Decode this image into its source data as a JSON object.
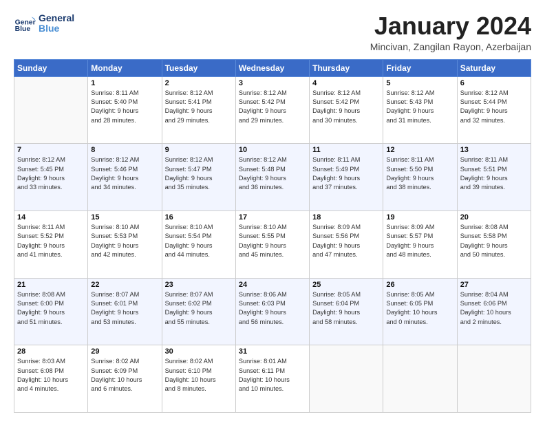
{
  "logo": {
    "line1": "General",
    "line2": "Blue"
  },
  "title": "January 2024",
  "subtitle": "Mincivan, Zangilan Rayon, Azerbaijan",
  "headers": [
    "Sunday",
    "Monday",
    "Tuesday",
    "Wednesday",
    "Thursday",
    "Friday",
    "Saturday"
  ],
  "weeks": [
    [
      {
        "num": "",
        "info": ""
      },
      {
        "num": "1",
        "info": "Sunrise: 8:11 AM\nSunset: 5:40 PM\nDaylight: 9 hours\nand 28 minutes."
      },
      {
        "num": "2",
        "info": "Sunrise: 8:12 AM\nSunset: 5:41 PM\nDaylight: 9 hours\nand 29 minutes."
      },
      {
        "num": "3",
        "info": "Sunrise: 8:12 AM\nSunset: 5:42 PM\nDaylight: 9 hours\nand 29 minutes."
      },
      {
        "num": "4",
        "info": "Sunrise: 8:12 AM\nSunset: 5:42 PM\nDaylight: 9 hours\nand 30 minutes."
      },
      {
        "num": "5",
        "info": "Sunrise: 8:12 AM\nSunset: 5:43 PM\nDaylight: 9 hours\nand 31 minutes."
      },
      {
        "num": "6",
        "info": "Sunrise: 8:12 AM\nSunset: 5:44 PM\nDaylight: 9 hours\nand 32 minutes."
      }
    ],
    [
      {
        "num": "7",
        "info": "Sunrise: 8:12 AM\nSunset: 5:45 PM\nDaylight: 9 hours\nand 33 minutes."
      },
      {
        "num": "8",
        "info": "Sunrise: 8:12 AM\nSunset: 5:46 PM\nDaylight: 9 hours\nand 34 minutes."
      },
      {
        "num": "9",
        "info": "Sunrise: 8:12 AM\nSunset: 5:47 PM\nDaylight: 9 hours\nand 35 minutes."
      },
      {
        "num": "10",
        "info": "Sunrise: 8:12 AM\nSunset: 5:48 PM\nDaylight: 9 hours\nand 36 minutes."
      },
      {
        "num": "11",
        "info": "Sunrise: 8:11 AM\nSunset: 5:49 PM\nDaylight: 9 hours\nand 37 minutes."
      },
      {
        "num": "12",
        "info": "Sunrise: 8:11 AM\nSunset: 5:50 PM\nDaylight: 9 hours\nand 38 minutes."
      },
      {
        "num": "13",
        "info": "Sunrise: 8:11 AM\nSunset: 5:51 PM\nDaylight: 9 hours\nand 39 minutes."
      }
    ],
    [
      {
        "num": "14",
        "info": "Sunrise: 8:11 AM\nSunset: 5:52 PM\nDaylight: 9 hours\nand 41 minutes."
      },
      {
        "num": "15",
        "info": "Sunrise: 8:10 AM\nSunset: 5:53 PM\nDaylight: 9 hours\nand 42 minutes."
      },
      {
        "num": "16",
        "info": "Sunrise: 8:10 AM\nSunset: 5:54 PM\nDaylight: 9 hours\nand 44 minutes."
      },
      {
        "num": "17",
        "info": "Sunrise: 8:10 AM\nSunset: 5:55 PM\nDaylight: 9 hours\nand 45 minutes."
      },
      {
        "num": "18",
        "info": "Sunrise: 8:09 AM\nSunset: 5:56 PM\nDaylight: 9 hours\nand 47 minutes."
      },
      {
        "num": "19",
        "info": "Sunrise: 8:09 AM\nSunset: 5:57 PM\nDaylight: 9 hours\nand 48 minutes."
      },
      {
        "num": "20",
        "info": "Sunrise: 8:08 AM\nSunset: 5:58 PM\nDaylight: 9 hours\nand 50 minutes."
      }
    ],
    [
      {
        "num": "21",
        "info": "Sunrise: 8:08 AM\nSunset: 6:00 PM\nDaylight: 9 hours\nand 51 minutes."
      },
      {
        "num": "22",
        "info": "Sunrise: 8:07 AM\nSunset: 6:01 PM\nDaylight: 9 hours\nand 53 minutes."
      },
      {
        "num": "23",
        "info": "Sunrise: 8:07 AM\nSunset: 6:02 PM\nDaylight: 9 hours\nand 55 minutes."
      },
      {
        "num": "24",
        "info": "Sunrise: 8:06 AM\nSunset: 6:03 PM\nDaylight: 9 hours\nand 56 minutes."
      },
      {
        "num": "25",
        "info": "Sunrise: 8:05 AM\nSunset: 6:04 PM\nDaylight: 9 hours\nand 58 minutes."
      },
      {
        "num": "26",
        "info": "Sunrise: 8:05 AM\nSunset: 6:05 PM\nDaylight: 10 hours\nand 0 minutes."
      },
      {
        "num": "27",
        "info": "Sunrise: 8:04 AM\nSunset: 6:06 PM\nDaylight: 10 hours\nand 2 minutes."
      }
    ],
    [
      {
        "num": "28",
        "info": "Sunrise: 8:03 AM\nSunset: 6:08 PM\nDaylight: 10 hours\nand 4 minutes."
      },
      {
        "num": "29",
        "info": "Sunrise: 8:02 AM\nSunset: 6:09 PM\nDaylight: 10 hours\nand 6 minutes."
      },
      {
        "num": "30",
        "info": "Sunrise: 8:02 AM\nSunset: 6:10 PM\nDaylight: 10 hours\nand 8 minutes."
      },
      {
        "num": "31",
        "info": "Sunrise: 8:01 AM\nSunset: 6:11 PM\nDaylight: 10 hours\nand 10 minutes."
      },
      {
        "num": "",
        "info": ""
      },
      {
        "num": "",
        "info": ""
      },
      {
        "num": "",
        "info": ""
      }
    ]
  ]
}
